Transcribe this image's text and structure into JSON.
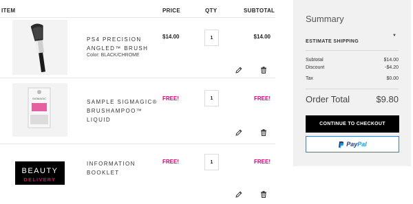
{
  "cart": {
    "headers": {
      "item": "ITEM",
      "price": "PRICE",
      "qty": "QTY",
      "subtotal": "SUBTOTAL"
    },
    "items": [
      {
        "name": "PS4 PRECISION ANGLED™ BRUSH",
        "color_label": "Color:",
        "color_value": "BLACK/CHROME",
        "price": "$14.00",
        "qty": "1",
        "subtotal": "$14.00",
        "image": "makeup-brush"
      },
      {
        "name": "SAMPLE SIGMAGIC® BRUSHAMPOO™ LIQUID",
        "price": "FREE!",
        "qty": "1",
        "subtotal": "FREE!",
        "image": "sample-packet",
        "packet_text": "SIGMAGIC"
      },
      {
        "name": "INFORMATION BOOKLET",
        "price": "FREE!",
        "qty": "1",
        "subtotal": "FREE!",
        "image": "booklet-logo",
        "logo_line1": "BEAUTY",
        "logo_line2": "DELIVERY"
      }
    ]
  },
  "summary": {
    "title": "Summary",
    "estimate_shipping": "ESTIMATE SHIPPING",
    "lines": [
      {
        "label": "Subtotal",
        "value": "$14.00"
      },
      {
        "label": "Discount",
        "value": "-$4.20"
      },
      {
        "label": "Tax",
        "value": "$0.00"
      }
    ],
    "order_total_label": "Order Total",
    "order_total_value": "$9.80",
    "checkout_label": "CONTINUE TO CHECKOUT",
    "paypal_label_1": "Pay",
    "paypal_label_2": "Pal"
  },
  "colors": {
    "free": "#d6007a",
    "checkout_bg": "#000000",
    "summary_bg": "#f1f1f1",
    "paypal_dark": "#253b80",
    "paypal_light": "#179bd7"
  },
  "icons": [
    "edit-pencil-icon",
    "trash-icon",
    "chevron-down-icon",
    "paypal-logo-icon"
  ]
}
